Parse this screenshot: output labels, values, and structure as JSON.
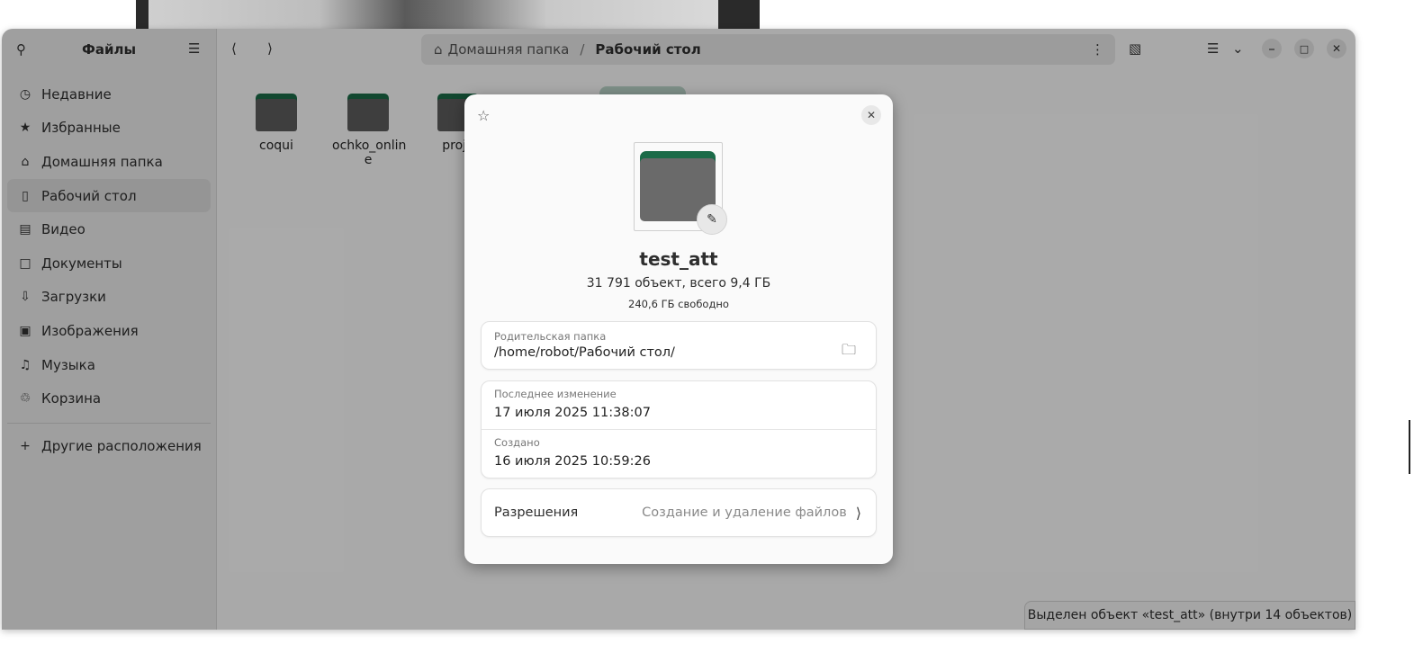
{
  "window": {
    "sidebar_title": "Файлы",
    "sidebar_items": [
      {
        "label": "Недавние",
        "icon": "clock-icon",
        "active": false
      },
      {
        "label": "Избранные",
        "icon": "star-icon",
        "active": false
      },
      {
        "label": "Домашняя папка",
        "icon": "home-icon",
        "active": false
      },
      {
        "label": "Рабочий стол",
        "icon": "desktop-icon",
        "active": true
      },
      {
        "label": "Видео",
        "icon": "video-icon",
        "active": false
      },
      {
        "label": "Документы",
        "icon": "document-icon",
        "active": false
      },
      {
        "label": "Загрузки",
        "icon": "download-icon",
        "active": false
      },
      {
        "label": "Изображения",
        "icon": "image-icon",
        "active": false
      },
      {
        "label": "Музыка",
        "icon": "music-icon",
        "active": false
      },
      {
        "label": "Корзина",
        "icon": "trash-icon",
        "active": false
      }
    ],
    "other_locations": "Другие расположения",
    "path": {
      "home": "Домашняя папка",
      "separator": "/",
      "current": "Рабочий стол"
    },
    "files": [
      "coqui",
      "ochko_onlin\ne",
      "proje"
    ],
    "status": "Выделен объект «test_att»  (внутри 14 объектов)"
  },
  "dialog": {
    "name": "test_att",
    "summary": "31 791 объект, всего 9,4 ГБ",
    "free_space": "240,6 ГБ свободно",
    "parent_label": "Родительская папка",
    "parent_value": "/home/robot/Рабочий стол/",
    "modified_label": "Последнее изменение",
    "modified_value": "17 июля 2025 11:38:07",
    "created_label": "Создано",
    "created_value": "16 июля 2025 10:59:26",
    "permissions_label": "Разрешения",
    "permissions_value": "Создание и удаление файлов"
  },
  "colors": {
    "folder_tab": "#1b6b48",
    "folder_body": "#5c5c5c"
  }
}
